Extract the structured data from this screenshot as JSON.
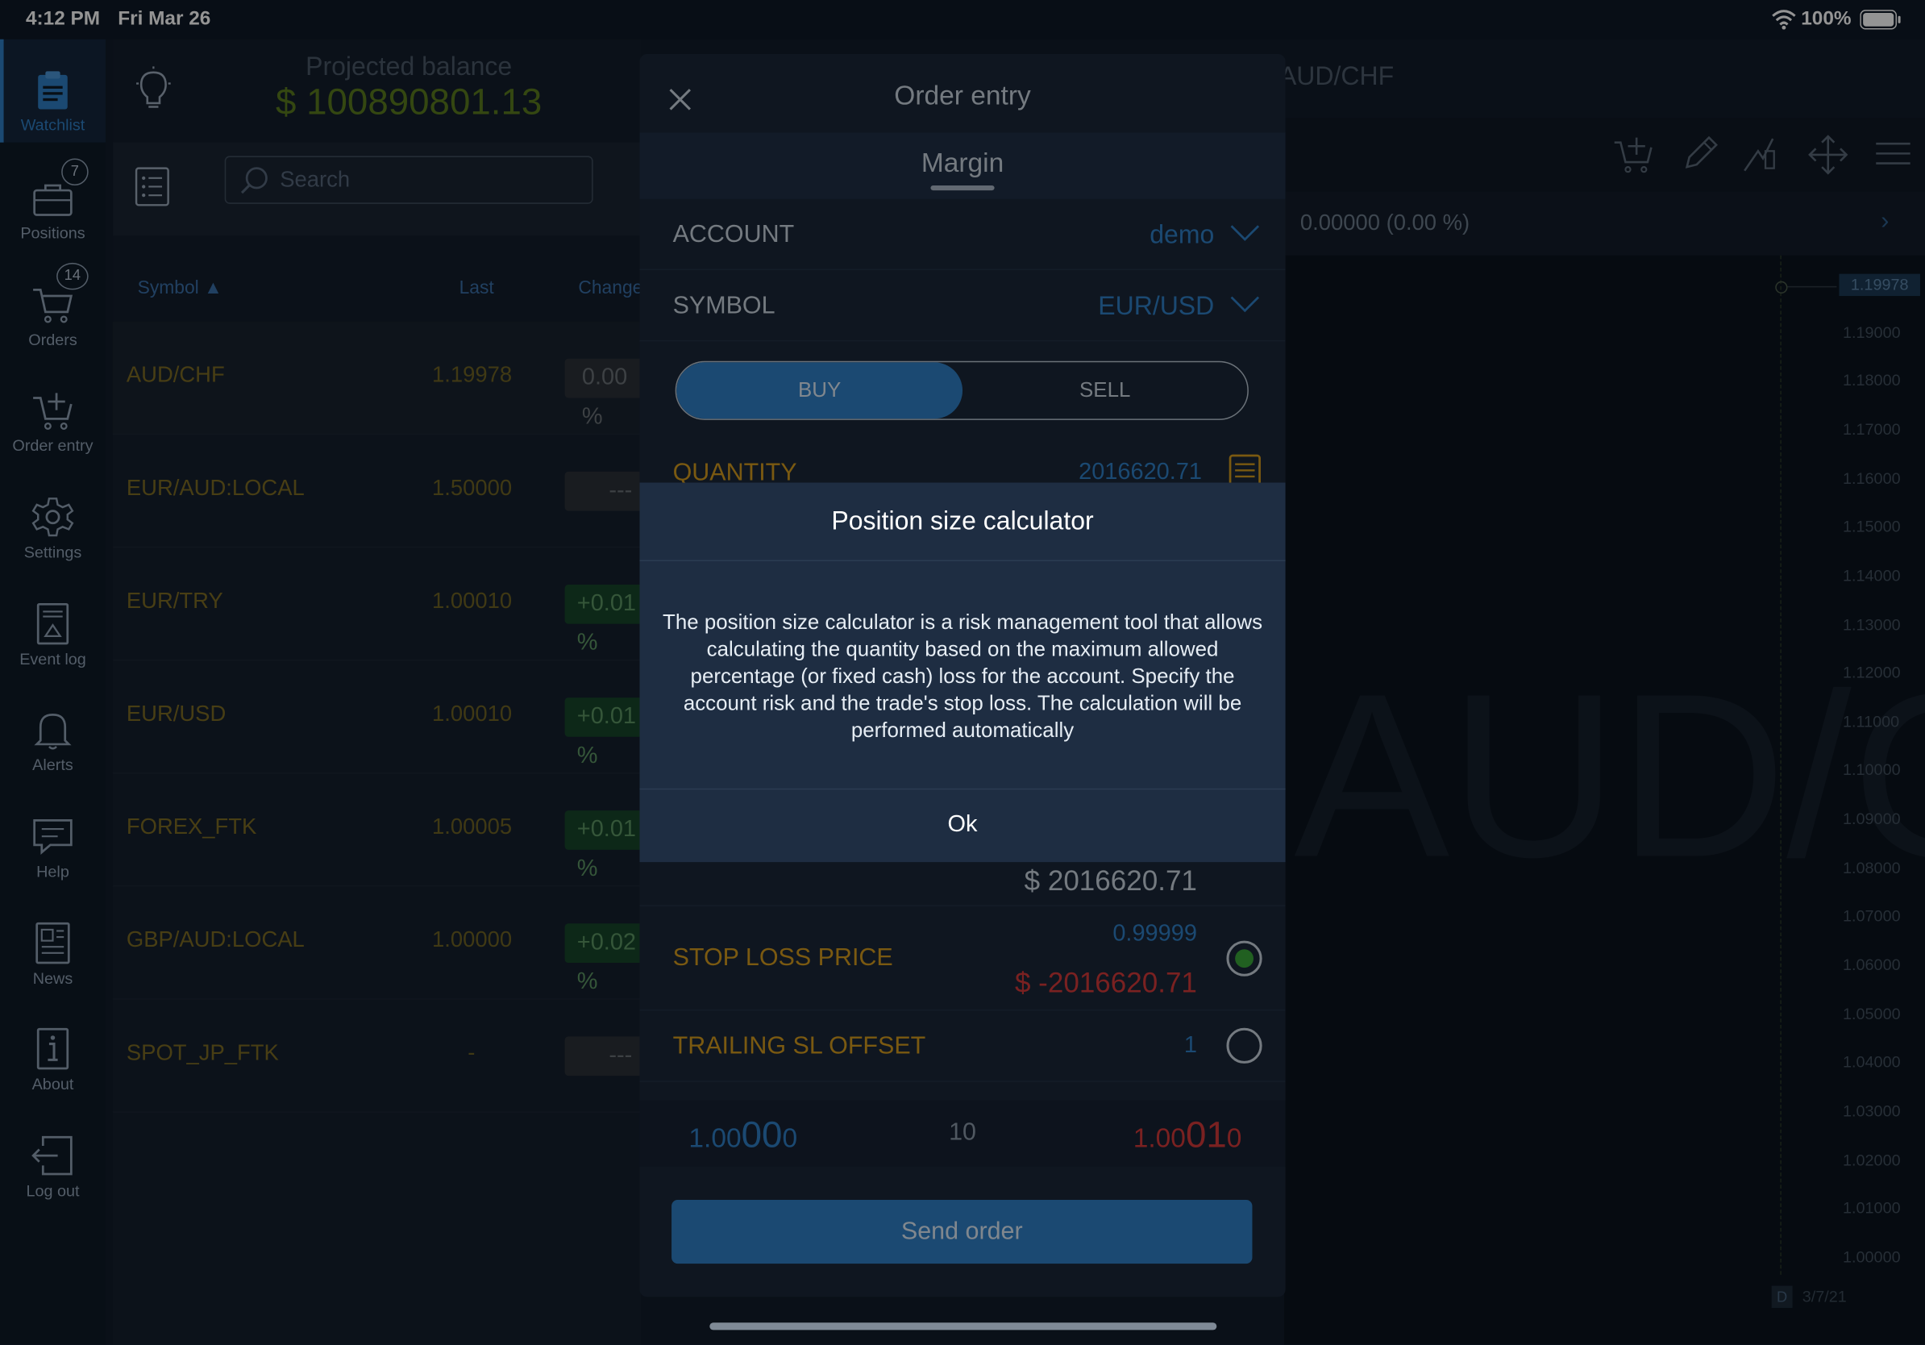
{
  "status_bar": {
    "time": "4:12 PM",
    "date": "Fri Mar 26",
    "battery": "100%"
  },
  "sidebar": {
    "items": [
      {
        "label": "Watchlist",
        "icon": "clipboard-icon",
        "active": true
      },
      {
        "label": "Positions",
        "icon": "briefcase-icon",
        "badge": "7"
      },
      {
        "label": "Orders",
        "icon": "cart-icon",
        "badge": "14"
      },
      {
        "label": "Order entry",
        "icon": "cart-plus-icon"
      },
      {
        "label": "Settings",
        "icon": "gear-icon"
      },
      {
        "label": "Event log",
        "icon": "event-log-icon"
      },
      {
        "label": "Alerts",
        "icon": "bell-icon"
      },
      {
        "label": "Help",
        "icon": "help-chat-icon"
      },
      {
        "label": "News",
        "icon": "newspaper-icon"
      },
      {
        "label": "About",
        "icon": "info-icon"
      },
      {
        "label": "Log out",
        "icon": "logout-icon"
      }
    ]
  },
  "watchlist": {
    "projected_label": "Projected balance",
    "projected_value": "$ 100890801.13",
    "search_placeholder": "Search",
    "columns": {
      "symbol": "Symbol",
      "last": "Last",
      "change": "Change"
    },
    "rows": [
      {
        "symbol": "AUD/CHF",
        "last": "1.19978",
        "change": "0.00 %",
        "change_style": "neutral"
      },
      {
        "symbol": "EUR/AUD:LOCAL",
        "last": "1.50000",
        "change": "---",
        "change_style": "neutral"
      },
      {
        "symbol": "EUR/TRY",
        "last": "1.00010",
        "change": "+0.01 %",
        "change_style": "up"
      },
      {
        "symbol": "EUR/USD",
        "last": "1.00010",
        "change": "+0.01 %",
        "change_style": "up"
      },
      {
        "symbol": "FOREX_FTK",
        "last": "1.00005",
        "change": "+0.01 %",
        "change_style": "up"
      },
      {
        "symbol": "GBP/AUD:LOCAL",
        "last": "1.00000",
        "change": "+0.02 %",
        "change_style": "up"
      },
      {
        "symbol": "SPOT_JP_FTK",
        "last": "-",
        "change": "---",
        "change_style": "neutral"
      }
    ]
  },
  "chart": {
    "symbol_title": "AUD/CHF",
    "watermark": "AUD/CHF",
    "change_text": "0.00000 (0.00 %)",
    "current_price_label": "1.19978",
    "price_ticks": [
      "1.19000",
      "1.18000",
      "1.17000",
      "1.16000",
      "1.15000",
      "1.14000",
      "1.13000",
      "1.12000",
      "1.11000",
      "1.10000",
      "1.09000",
      "1.08000",
      "1.07000",
      "1.06000",
      "1.05000",
      "1.04000",
      "1.03000",
      "1.02000",
      "1.01000",
      "1.00000"
    ],
    "period_badge": "D",
    "date_label": "3/7/21"
  },
  "order_entry": {
    "title": "Order entry",
    "tab": "Margin",
    "account_label": "ACCOUNT",
    "account_value": "demo",
    "symbol_label": "SYMBOL",
    "symbol_value": "EUR/USD",
    "buy_label": "BUY",
    "sell_label": "SELL",
    "quantity_label": "QUANTITY",
    "quantity_value": "2016620.71",
    "amount_value": "$ 2016620.71",
    "stop_loss_label": "STOP LOSS PRICE",
    "stop_loss_price": "0.99999",
    "stop_loss_amount": "$ -2016620.71",
    "trailing_label": "TRAILING SL OFFSET",
    "trailing_value": "1",
    "bid": {
      "prefix": "1.00",
      "big": "00",
      "suffix": "0"
    },
    "spread": "10",
    "ask": {
      "prefix": "1.00",
      "big": "01",
      "suffix": "0"
    },
    "send_label": "Send order"
  },
  "dialog": {
    "title": "Position size calculator",
    "body": "The position size calculator is a risk management tool that allows calculating the quantity based on the maximum allowed percentage (or fixed cash) loss for the account. Specify the account risk and the trade's stop loss. The calculation will be performed automatically",
    "ok_label": "Ok"
  },
  "colors": {
    "accent_blue": "#2f7fc4",
    "gold": "#d29a1e",
    "green": "#3aa63a",
    "red": "#d23a3a"
  }
}
